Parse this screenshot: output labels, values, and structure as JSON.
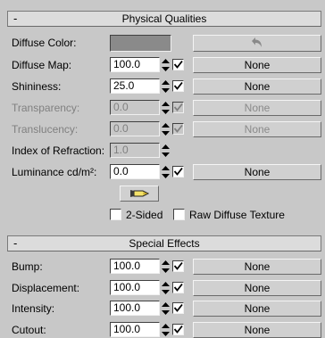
{
  "physical": {
    "title": "Physical Qualities",
    "collapse_symbol": "-",
    "diffuse_color": {
      "label": "Diffuse Color:",
      "swatch_color": "#8a8a8a",
      "undo_icon": "undo-arrow-icon"
    },
    "diffuse_map": {
      "label": "Diffuse Map:",
      "value": "100.0",
      "checked": true,
      "button": "None"
    },
    "shininess": {
      "label": "Shininess:",
      "value": "25.0",
      "checked": true,
      "button": "None"
    },
    "transparency": {
      "label": "Transparency:",
      "value": "0.0",
      "checked": true,
      "button": "None",
      "disabled": true
    },
    "translucency": {
      "label": "Translucency:",
      "value": "0.0",
      "checked": true,
      "button": "None",
      "disabled": true
    },
    "ior": {
      "label": "Index of Refraction:",
      "value": "1.0",
      "disabled": true
    },
    "luminance": {
      "label": "Luminance cd/m²:",
      "value": "0.0",
      "checked": true,
      "button": "None"
    },
    "bulb_icon": "lightbulb-icon",
    "two_sided": {
      "label": "2-Sided",
      "checked": false
    },
    "raw_diffuse": {
      "label": "Raw Diffuse Texture",
      "checked": false
    }
  },
  "special": {
    "title": "Special Effects",
    "collapse_symbol": "-",
    "bump": {
      "label": "Bump:",
      "value": "100.0",
      "checked": true,
      "button": "None"
    },
    "displacement": {
      "label": "Displacement:",
      "value": "100.0",
      "checked": true,
      "button": "None"
    },
    "intensity": {
      "label": "Intensity:",
      "value": "100.0",
      "checked": true,
      "button": "None"
    },
    "cutout": {
      "label": "Cutout:",
      "value": "100.0",
      "checked": true,
      "button": "None"
    }
  }
}
